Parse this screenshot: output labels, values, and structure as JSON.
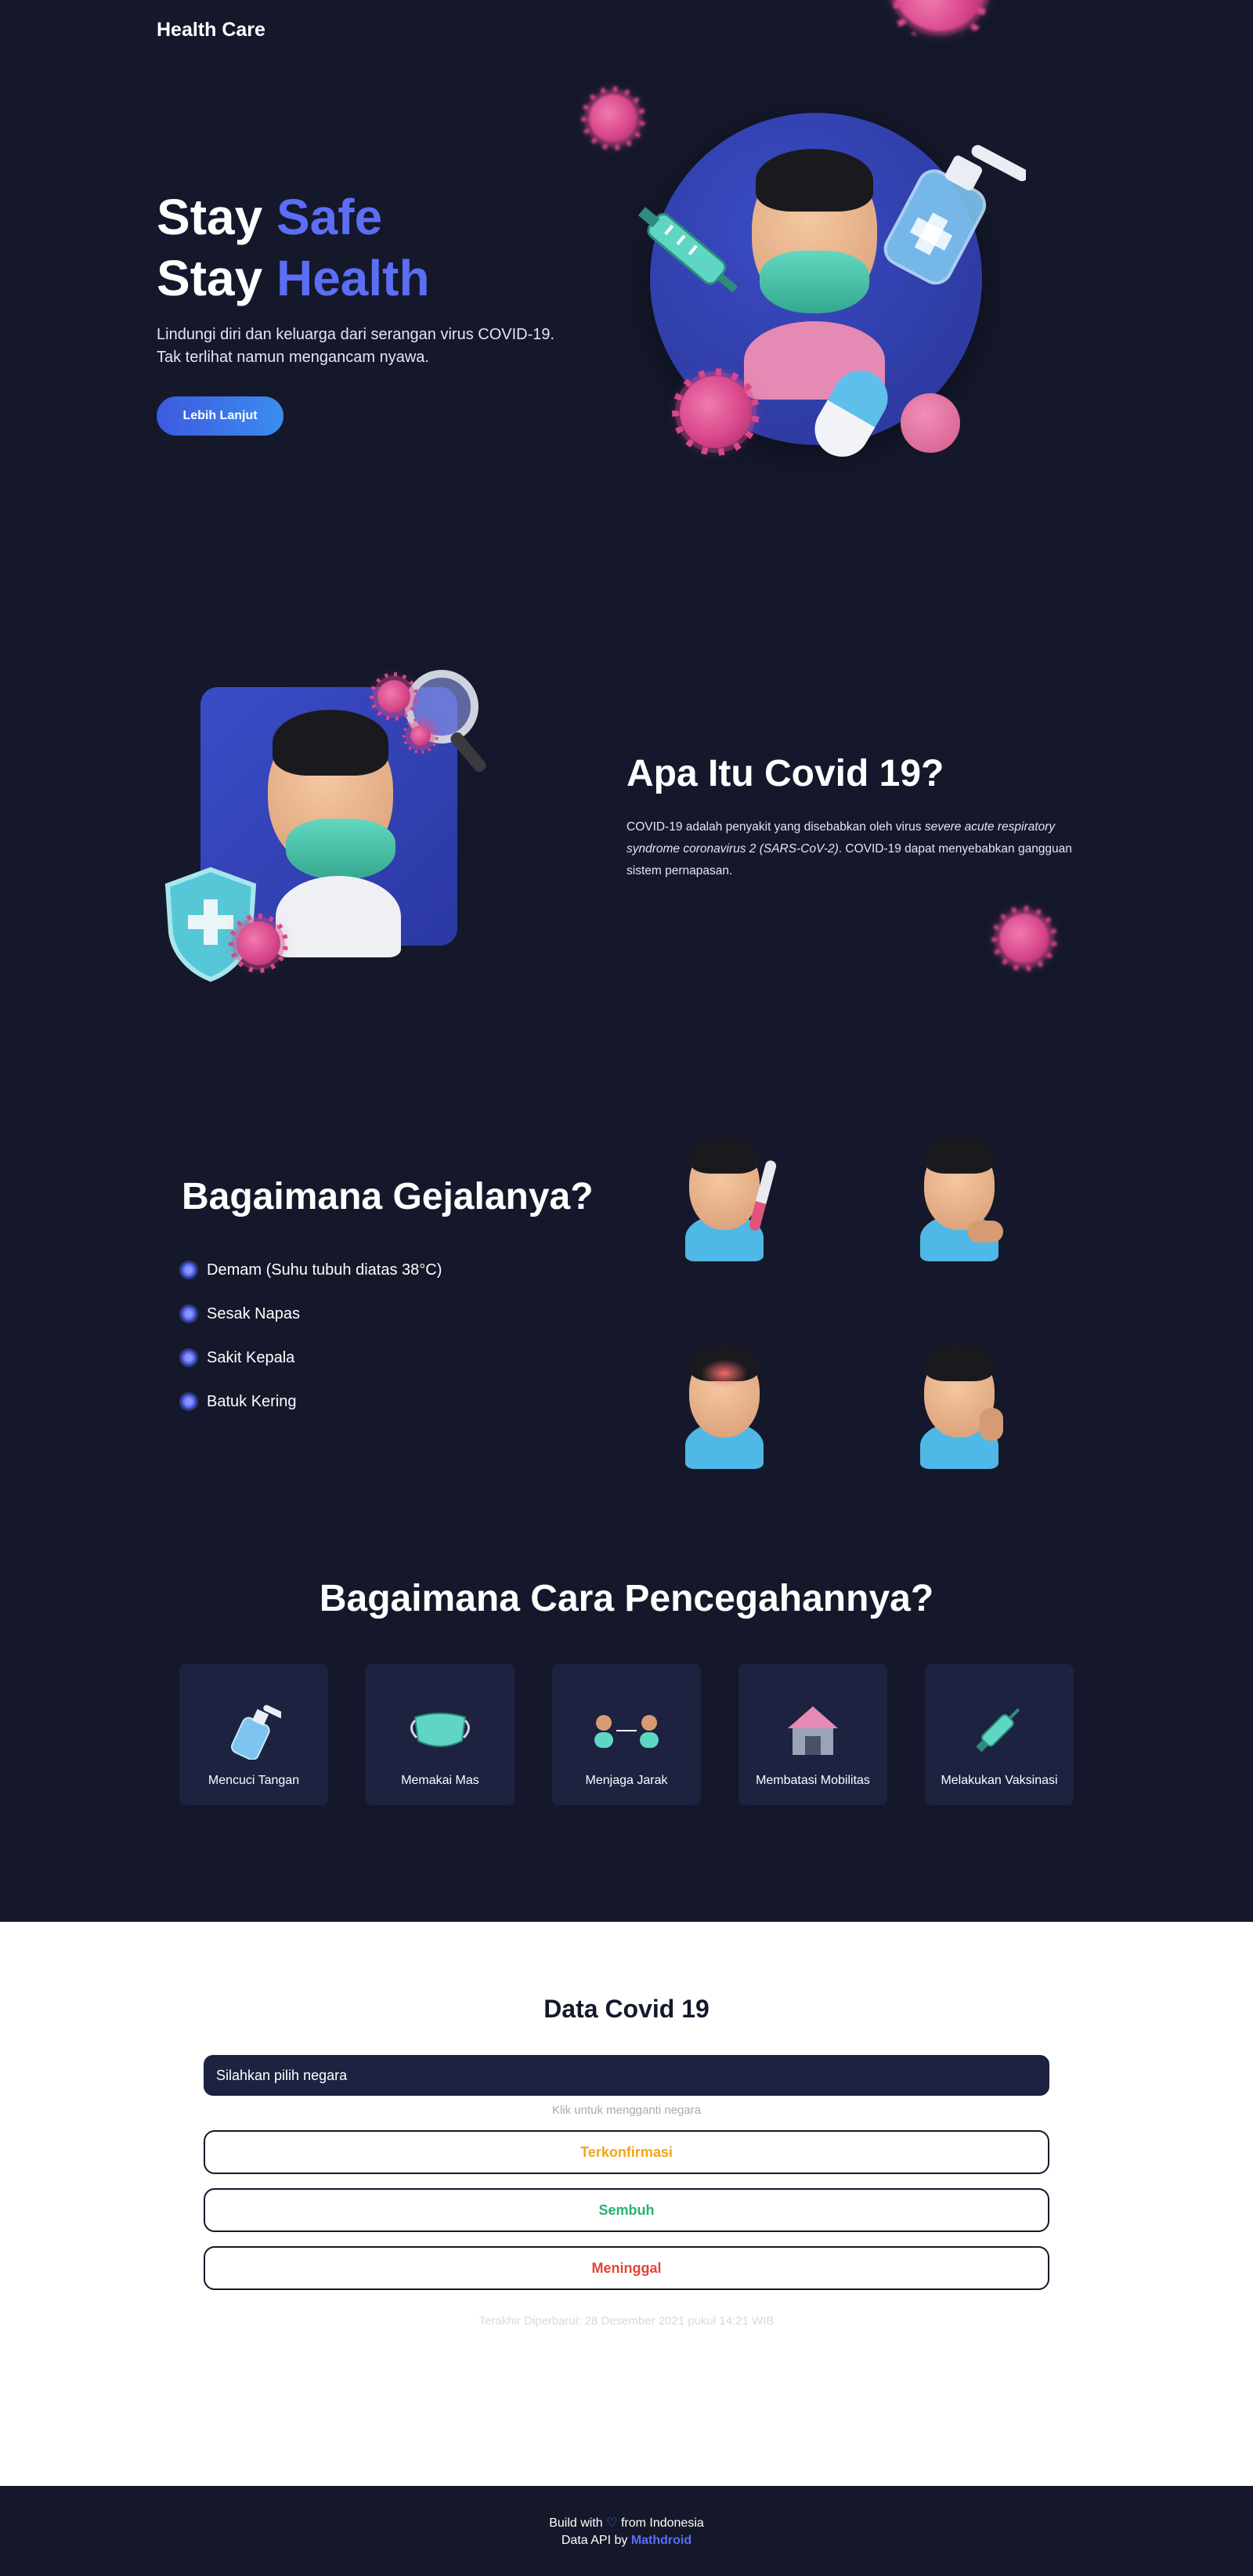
{
  "header": {
    "brand": "Health Care"
  },
  "hero": {
    "line1_word": "Stay",
    "line1_accent": "Safe",
    "line2_word": "Stay",
    "line2_accent": "Health",
    "description_line1": "Lindungi diri dan keluarga dari serangan virus COVID-19.",
    "description_line2": "Tak terlihat namun mengancam nyawa.",
    "button": "Lebih Lanjut"
  },
  "about": {
    "title": "Apa Itu Covid 19?",
    "desc_start": "COVID-19 adalah penyakit yang disebabkan oleh virus ",
    "desc_italic": "severe acute respiratory syndrome coronavirus 2 (SARS-CoV-2)",
    "desc_end": ". COVID-19 dapat menyebabkan gangguan sistem pernapasan."
  },
  "symptoms": {
    "title": "Bagaimana Gejalanya?",
    "items": [
      "Demam (Suhu tubuh diatas 38°C)",
      "Sesak Napas",
      "Sakit Kepala",
      "Batuk Kering"
    ]
  },
  "prevention": {
    "title": "Bagaimana Cara Pencegahannya?",
    "items": [
      {
        "label": "Mencuci Tangan",
        "icon": "hand-sanitizer-icon"
      },
      {
        "label": "Memakai Mas",
        "icon": "face-mask-icon"
      },
      {
        "label": "Menjaga Jarak",
        "icon": "social-distance-icon"
      },
      {
        "label": "Membatasi Mobilitas",
        "icon": "house-icon"
      },
      {
        "label": "Melakukan Vaksinasi",
        "icon": "syringe-icon"
      }
    ]
  },
  "data": {
    "title": "Data Covid 19",
    "select_value": "Silahkan pilih negara",
    "hint": "Klik untuk mengganti negara",
    "confirmed": "Terkonfirmasi",
    "recovered": "Sembuh",
    "deaths": "Meninggal",
    "updated": "Terakhir Diperbarui: 28 Desember 2021 pukul 14:21 WIB"
  },
  "footer": {
    "build_prefix": "Build with",
    "heart": "♡",
    "build_suffix": "from Indonesia",
    "api_prefix": "Data API by",
    "api_link": "Mathdroid"
  },
  "colors": {
    "background": "#14182a",
    "accent": "#5b6ef5",
    "confirmed": "#f2a51a",
    "recovered": "#27b36f",
    "deaths": "#e0463c"
  }
}
